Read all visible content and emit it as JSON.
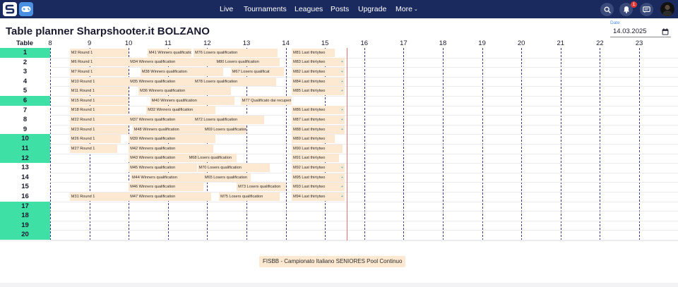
{
  "nav": {
    "items": [
      "Live",
      "Tournaments",
      "Leagues",
      "Posts",
      "Upgrade"
    ],
    "more_label": "More",
    "notification_count": "1",
    "icons": [
      "logo-icon",
      "gamepad-icon",
      "search-icon",
      "bell-icon",
      "chat-icon",
      "avatar"
    ]
  },
  "page": {
    "title": "Table planner Sharpshooter.it BOLZANO",
    "date_label": "Date",
    "date_value": "14.03.2025"
  },
  "planner": {
    "table_header": "Table",
    "hours": [
      "8",
      "9",
      "10",
      "11",
      "12",
      "13",
      "14",
      "15",
      "16",
      "17",
      "18",
      "19",
      "20",
      "21",
      "22",
      "23"
    ],
    "tables": [
      {
        "label": "1",
        "highlight": true
      },
      {
        "label": "2",
        "highlight": false
      },
      {
        "label": "3",
        "highlight": false
      },
      {
        "label": "4",
        "highlight": false
      },
      {
        "label": "5",
        "highlight": false
      },
      {
        "label": "6",
        "highlight": true
      },
      {
        "label": "7",
        "highlight": false
      },
      {
        "label": "8",
        "highlight": false
      },
      {
        "label": "9",
        "highlight": false
      },
      {
        "label": "10",
        "highlight": true
      },
      {
        "label": "11",
        "highlight": true
      },
      {
        "label": "12",
        "highlight": true
      },
      {
        "label": "13",
        "highlight": false
      },
      {
        "label": "14",
        "highlight": false
      },
      {
        "label": "15",
        "highlight": false
      },
      {
        "label": "16",
        "highlight": false
      },
      {
        "label": "17",
        "highlight": true
      },
      {
        "label": "18",
        "highlight": true
      },
      {
        "label": "19",
        "highlight": true
      },
      {
        "label": "20",
        "highlight": true
      }
    ],
    "matches": [
      {
        "table": 1,
        "start": 8.5,
        "end": 10.0,
        "label": "M2 Round 1",
        "mark": false
      },
      {
        "table": 1,
        "start": 10.48,
        "end": 11.6,
        "label": "M41 Winners qualification",
        "mark": false
      },
      {
        "table": 1,
        "start": 11.65,
        "end": 13.8,
        "label": "M76 Losers qualification",
        "mark": false
      },
      {
        "table": 1,
        "start": 14.15,
        "end": 15.25,
        "label": "M81 Last thirtytwo",
        "mark": false
      },
      {
        "table": 2,
        "start": 8.5,
        "end": 10.0,
        "label": "M6 Round 1",
        "mark": false
      },
      {
        "table": 2,
        "start": 10.0,
        "end": 12.2,
        "label": "M34 Winners qualification",
        "mark": false
      },
      {
        "table": 2,
        "start": 12.2,
        "end": 13.85,
        "label": "M80 Losers qualification",
        "mark": false
      },
      {
        "table": 2,
        "start": 14.15,
        "end": 15.5,
        "label": "M83 Last thirtytwo",
        "mark": true
      },
      {
        "table": 3,
        "start": 8.5,
        "end": 10.0,
        "label": "M7 Round 1",
        "mark": false
      },
      {
        "table": 3,
        "start": 10.3,
        "end": 12.4,
        "label": "M38 Winners qualification",
        "mark": false
      },
      {
        "table": 3,
        "start": 12.6,
        "end": 13.95,
        "label": "M67 Losers qualificat",
        "mark": false
      },
      {
        "table": 3,
        "start": 14.15,
        "end": 15.5,
        "label": "M82 Last thirtytwo",
        "mark": true
      },
      {
        "table": 4,
        "start": 8.5,
        "end": 10.0,
        "label": "M10 Round 1",
        "mark": false
      },
      {
        "table": 4,
        "start": 10.0,
        "end": 11.65,
        "label": "M35 Winners qualification",
        "mark": false
      },
      {
        "table": 4,
        "start": 11.65,
        "end": 13.75,
        "label": "M78 Losers qualification",
        "mark": false
      },
      {
        "table": 4,
        "start": 14.15,
        "end": 15.5,
        "label": "M84 Last thirtytwo",
        "mark": true
      },
      {
        "table": 5,
        "start": 8.5,
        "end": 10.0,
        "label": "M11 Round 1",
        "mark": false
      },
      {
        "table": 5,
        "start": 10.25,
        "end": 12.6,
        "label": "M36 Winners qualification",
        "mark": false
      },
      {
        "table": 5,
        "start": 14.15,
        "end": 15.5,
        "label": "M85 Last thirtytwo",
        "mark": true
      },
      {
        "table": 6,
        "start": 8.5,
        "end": 10.0,
        "label": "M15 Round 1",
        "mark": false
      },
      {
        "table": 6,
        "start": 10.55,
        "end": 12.7,
        "label": "M40 Winners qualification",
        "mark": false
      },
      {
        "table": 6,
        "start": 12.85,
        "end": 14.15,
        "label": "M77 Qualificato dai recuperi",
        "mark": false
      },
      {
        "table": 7,
        "start": 8.5,
        "end": 10.0,
        "label": "M18 Round 1",
        "mark": false
      },
      {
        "table": 7,
        "start": 10.45,
        "end": 12.2,
        "label": "M32 Winners qualification",
        "mark": false
      },
      {
        "table": 7,
        "start": 14.15,
        "end": 15.5,
        "label": "M86 Last thirtytwo",
        "mark": true
      },
      {
        "table": 8,
        "start": 8.5,
        "end": 10.0,
        "label": "M22 Round 1",
        "mark": false
      },
      {
        "table": 8,
        "start": 10.0,
        "end": 11.65,
        "label": "M37 Winners qualification",
        "mark": false
      },
      {
        "table": 8,
        "start": 11.65,
        "end": 13.45,
        "label": "M72 Losers qualification",
        "mark": false
      },
      {
        "table": 8,
        "start": 14.15,
        "end": 15.5,
        "label": "M87 Last thirtytwo",
        "mark": true
      },
      {
        "table": 9,
        "start": 8.5,
        "end": 10.0,
        "label": "M23 Round 1",
        "mark": false
      },
      {
        "table": 9,
        "start": 10.1,
        "end": 11.9,
        "label": "M48 Winners qualification",
        "mark": false
      },
      {
        "table": 9,
        "start": 11.9,
        "end": 13.0,
        "label": "M69 Losers qualification",
        "mark": false
      },
      {
        "table": 9,
        "start": 14.15,
        "end": 15.5,
        "label": "M88 Last thirtytwo",
        "mark": true
      },
      {
        "table": 10,
        "start": 8.5,
        "end": 9.8,
        "label": "M26 Round 1",
        "mark": false
      },
      {
        "table": 10,
        "start": 10.0,
        "end": 12.2,
        "label": "M39 Winners qualification",
        "mark": false
      },
      {
        "table": 10,
        "start": 14.15,
        "end": 15.25,
        "label": "M89 Last thirtytwo",
        "mark": false
      },
      {
        "table": 11,
        "start": 8.5,
        "end": 9.7,
        "label": "M27 Round 1",
        "mark": false
      },
      {
        "table": 11,
        "start": 10.0,
        "end": 12.15,
        "label": "M42 Winners qualification",
        "mark": false
      },
      {
        "table": 11,
        "start": 14.15,
        "end": 15.45,
        "label": "M90 Last thirtytwo",
        "mark": false
      },
      {
        "table": 12,
        "start": 10.0,
        "end": 11.5,
        "label": "M43 Winners qualification",
        "mark": false
      },
      {
        "table": 12,
        "start": 11.5,
        "end": 12.75,
        "label": "M68 Losers qualification",
        "mark": false
      },
      {
        "table": 12,
        "start": 14.15,
        "end": 15.35,
        "label": "M91 Last thirtytwo",
        "mark": false
      },
      {
        "table": 13,
        "start": 10.0,
        "end": 11.75,
        "label": "M45 Winners qualification",
        "mark": false
      },
      {
        "table": 13,
        "start": 11.75,
        "end": 13.6,
        "label": "M70 Losers qualification",
        "mark": false
      },
      {
        "table": 13,
        "start": 14.15,
        "end": 15.5,
        "label": "M92 Last thirtytwo",
        "mark": true
      },
      {
        "table": 14,
        "start": 10.05,
        "end": 11.9,
        "label": "M44 Winners qualification",
        "mark": false
      },
      {
        "table": 14,
        "start": 11.9,
        "end": 13.1,
        "label": "M65 Losers qualification",
        "mark": false
      },
      {
        "table": 14,
        "start": 14.15,
        "end": 15.5,
        "label": "M95 Last thirtytwo",
        "mark": true
      },
      {
        "table": 15,
        "start": 10.0,
        "end": 11.9,
        "label": "M46 Winners qualification",
        "mark": false
      },
      {
        "table": 15,
        "start": 12.75,
        "end": 14.0,
        "label": "M73 Losers qualification",
        "mark": false
      },
      {
        "table": 15,
        "start": 14.15,
        "end": 15.5,
        "label": "M93 Last thirtytwo",
        "mark": true
      },
      {
        "table": 16,
        "start": 8.5,
        "end": 10.0,
        "label": "M31 Round 1",
        "mark": false
      },
      {
        "table": 16,
        "start": 10.0,
        "end": 12.1,
        "label": "M47 Winners qualification",
        "mark": false
      },
      {
        "table": 16,
        "start": 12.3,
        "end": 13.85,
        "label": "M75 Losers qualification",
        "mark": false
      },
      {
        "table": 16,
        "start": 14.15,
        "end": 15.5,
        "label": "M94 Last thirtytwo",
        "mark": true
      }
    ],
    "mark_glyph": "+",
    "match_color": "#fde9d2",
    "highlight_color": "#3ee0a6",
    "now_time": 15.55,
    "now_line_color": "#e57373"
  },
  "footer": {
    "tournament_tag": "FISBB - Campionato Italiano SENIORES Pool Continuo"
  }
}
